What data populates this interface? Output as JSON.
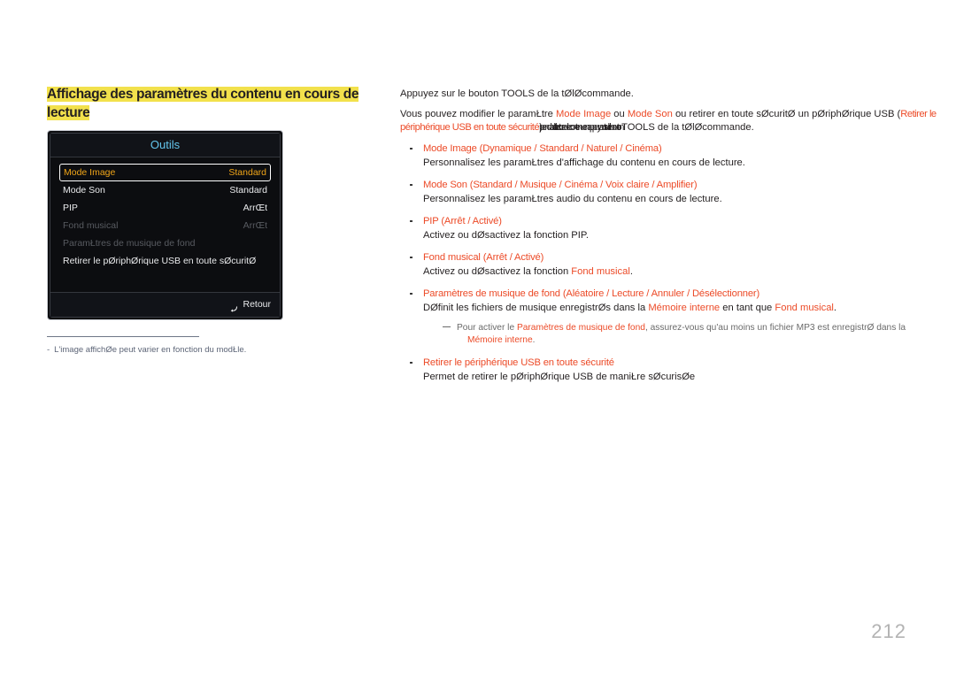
{
  "heading": {
    "line1": "Affichage des paramètres du contenu en cours de",
    "line2": "lecture"
  },
  "osd": {
    "title": "Outils",
    "rows": [
      {
        "label": "Mode Image",
        "value": "Standard",
        "state": "selected"
      },
      {
        "label": "Mode Son",
        "value": "Standard",
        "state": "normal"
      },
      {
        "label": "PIP",
        "value": "ArrŒt",
        "state": "normal"
      },
      {
        "label": "Fond musical",
        "value": "ArrŒt",
        "state": "disabled"
      },
      {
        "label": "ParamŁtres de musique de fond",
        "value": "",
        "state": "disabled"
      },
      {
        "label": "Retirer le pØriphØrique USB en toute sØcuritØ",
        "value": "",
        "state": "normal"
      }
    ],
    "return_label": "Retour",
    "return_icon": "return-arrow-icon"
  },
  "footnote": {
    "dash": "-",
    "text": "L'image affichØe peut varier en fonction du modŁle."
  },
  "intro": {
    "p1": "Appuyez sur le bouton TOOLS de la tØlØcommande.",
    "p2_a": "Vous pouvez modifier le paramŁtre ",
    "p2_b": "Mode Image",
    "p2_c": " ou ",
    "p2_d": "Mode Son",
    "p2_e": " ou retirer en toute sØcuritØ un pØriphØrique USB (",
    "p2_f": "Retirer le périphérique USB en toute sécurité",
    "p2_g": ") pendant la lecture de contenu en appuyant sur le bouton",
    "p2_h": "TOOLS",
    "p2_i": " de la tØlØcommande."
  },
  "bullets": [
    {
      "name": "mode-image",
      "head_main": "Mode Image",
      "head_options": " (Dynamique / Standard / Naturel / Cinéma)",
      "body": "Personnalisez les paramŁtres d'affichage du contenu en cours de lecture."
    },
    {
      "name": "mode-son",
      "head_main": "Mode Son",
      "head_options": " (Standard / Musique / Cinéma / Voix claire / Amplifier)",
      "body": "Personnalisez les paramŁtres audio du contenu en cours de lecture."
    },
    {
      "name": "pip",
      "head_main": "PIP",
      "head_options": " (Arrêt / Activé)",
      "body": "Activez ou dØsactivez la fonction PIP."
    },
    {
      "name": "fond-musical",
      "head_main": "Fond musical",
      "head_options": " (Arrêt / Activé)",
      "body_pre": "Activez ou dØsactivez la fonction ",
      "body_red": "Fond musical",
      "body_post": "."
    },
    {
      "name": "parametres-musique-fond",
      "head_main": "Paramètres de musique de fond",
      "head_options": " (Aléatoire / Lecture / Annuler / Désélectionner)",
      "body_pre": "DØfinit les fichiers de musique enregistrØs dans la ",
      "body_red1": "Mémoire interne",
      "body_mid": " en tant que ",
      "body_red2": "Fond musical",
      "body_post": "."
    },
    {
      "name": "retirer-usb",
      "head_main": "Retirer le périphérique USB en toute sécurité",
      "head_options": "",
      "body": "Permet de retirer le pØriphØrique USB de maniŁre sØcurisØe"
    }
  ],
  "note": {
    "pre": "Pour activer le ",
    "red1": "Paramètres de musique de fond",
    "mid": ", assurez-vous qu'au moins un fichier MP3 est enregistrØ dans la",
    "red2": "Mémoire interne",
    "post": "."
  },
  "page_number": "212",
  "colors": {
    "accent_red": "#ec4a27",
    "highlight_yellow": "#f2e14c",
    "osd_title_blue": "#63c6ee",
    "osd_selected_amber": "#f0a518",
    "osd_disabled_gray": "#585b61",
    "footnote_blue_gray": "#5d6577",
    "page_number_gray": "#b3b3b3"
  }
}
